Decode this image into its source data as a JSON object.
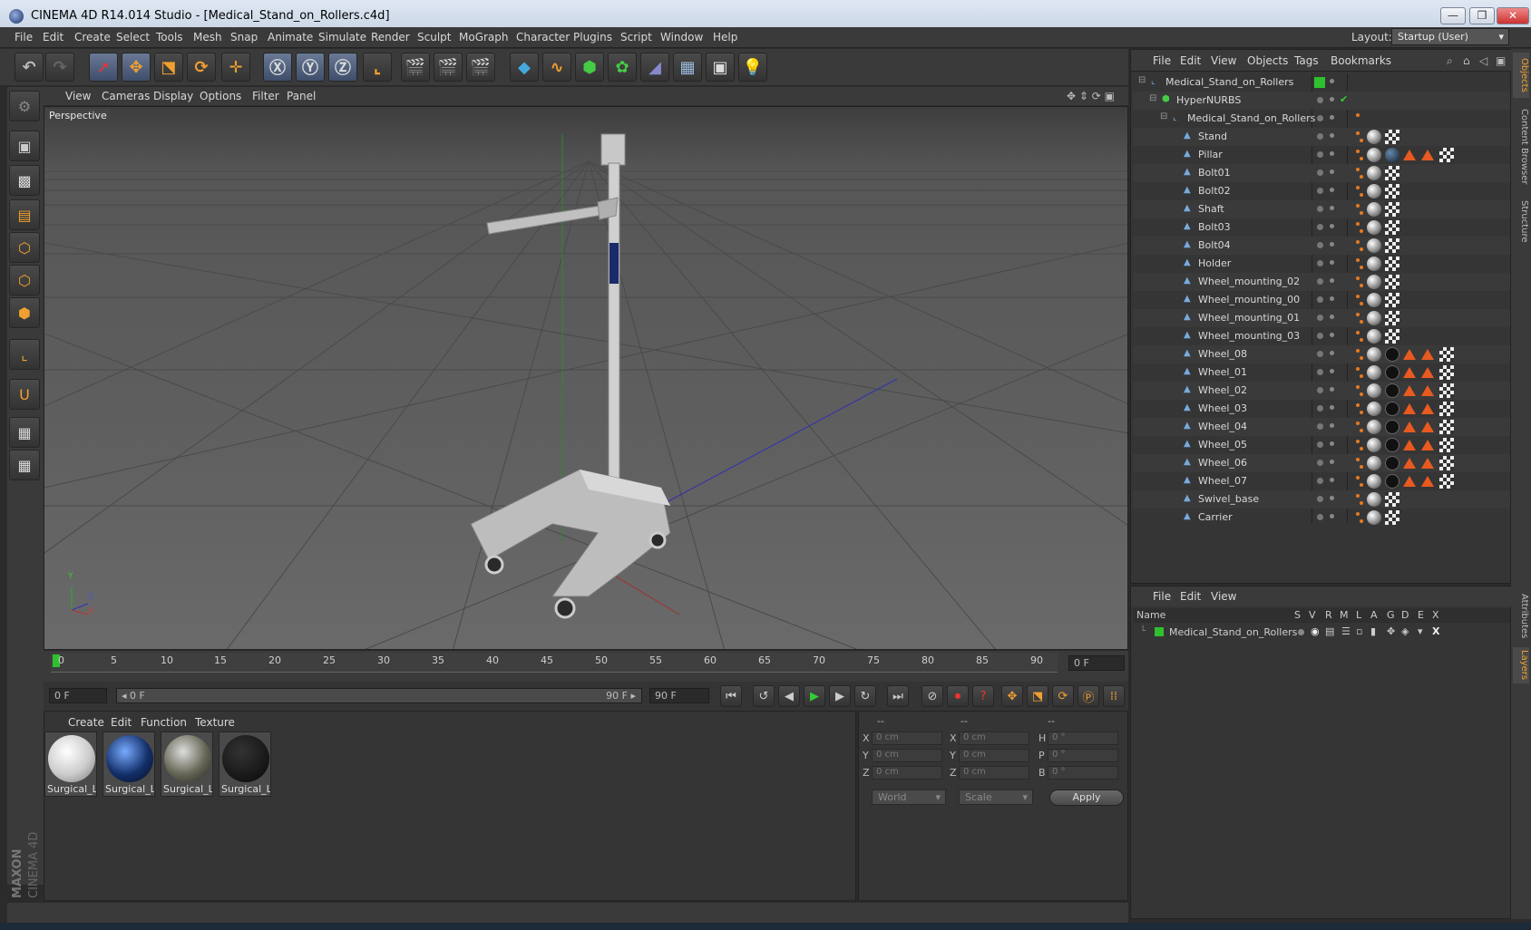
{
  "window": {
    "title": "CINEMA 4D R14.014 Studio - [Medical_Stand_on_Rollers.c4d]",
    "min": "—",
    "max": "❐",
    "close": "✕"
  },
  "menu": [
    "File",
    "Edit",
    "Create",
    "Select",
    "Tools",
    "Mesh",
    "Snap",
    "Animate",
    "Simulate",
    "Render",
    "Sculpt",
    "MoGraph",
    "Character",
    "Plugins",
    "Script",
    "Window",
    "Help"
  ],
  "layout": {
    "label": "Layout:",
    "value": "Startup (User)"
  },
  "viewport": {
    "menu": [
      "View",
      "Cameras",
      "Display",
      "Options",
      "Filter",
      "Panel"
    ],
    "label": "Perspective",
    "axis_y": "Y",
    "axis_z": "Z",
    "axis_x": "X"
  },
  "timeline": {
    "ticks": [
      "0",
      "5",
      "10",
      "15",
      "20",
      "25",
      "30",
      "35",
      "40",
      "45",
      "50",
      "55",
      "60",
      "65",
      "70",
      "75",
      "80",
      "85",
      "90"
    ],
    "current_frame": "0 F",
    "start_field": "0 F",
    "range_start": "◂ 0 F",
    "range_end": "90 F ▸",
    "end_field": "90 F"
  },
  "materials": {
    "menu": [
      "Create",
      "Edit",
      "Function",
      "Texture"
    ],
    "items": [
      "Surgical_Li",
      "Surgical_Li",
      "Surgical_Li",
      "Surgical_Li"
    ]
  },
  "coords": {
    "headers": [
      "--",
      "--",
      "--"
    ],
    "rows": [
      {
        "a": "X",
        "av": "0 cm",
        "b": "X",
        "bv": "0 cm",
        "c": "H",
        "cv": "0 °"
      },
      {
        "a": "Y",
        "av": "0 cm",
        "b": "Y",
        "bv": "0 cm",
        "c": "P",
        "cv": "0 °"
      },
      {
        "a": "Z",
        "av": "0 cm",
        "b": "Z",
        "bv": "0 cm",
        "c": "B",
        "cv": "0 °"
      }
    ],
    "space": "World",
    "mode": "Scale",
    "apply": "Apply"
  },
  "objects": {
    "menu": [
      "File",
      "Edit",
      "View",
      "Objects",
      "Tags",
      "Bookmarks"
    ],
    "items": [
      {
        "name": "Medical_Stand_on_Rollers",
        "depth": 0
      },
      {
        "name": "HyperNURBS",
        "depth": 1
      },
      {
        "name": "Medical_Stand_on_Rollers",
        "depth": 2
      },
      {
        "name": "Stand",
        "depth": 3
      },
      {
        "name": "Pillar",
        "depth": 3
      },
      {
        "name": "Bolt01",
        "depth": 3
      },
      {
        "name": "Bolt02",
        "depth": 3
      },
      {
        "name": "Shaft",
        "depth": 3
      },
      {
        "name": "Bolt03",
        "depth": 3
      },
      {
        "name": "Bolt04",
        "depth": 3
      },
      {
        "name": "Holder",
        "depth": 3
      },
      {
        "name": "Wheel_mounting_02",
        "depth": 3
      },
      {
        "name": "Wheel_mounting_00",
        "depth": 3
      },
      {
        "name": "Wheel_mounting_01",
        "depth": 3
      },
      {
        "name": "Wheel_mounting_03",
        "depth": 3
      },
      {
        "name": "Wheel_08",
        "depth": 3
      },
      {
        "name": "Wheel_01",
        "depth": 3
      },
      {
        "name": "Wheel_02",
        "depth": 3
      },
      {
        "name": "Wheel_03",
        "depth": 3
      },
      {
        "name": "Wheel_04",
        "depth": 3
      },
      {
        "name": "Wheel_05",
        "depth": 3
      },
      {
        "name": "Wheel_06",
        "depth": 3
      },
      {
        "name": "Wheel_07",
        "depth": 3
      },
      {
        "name": "Swivel_base",
        "depth": 3
      },
      {
        "name": "Carrier",
        "depth": 3
      }
    ]
  },
  "layers": {
    "menu": [
      "File",
      "Edit",
      "View"
    ],
    "columns": [
      "Name",
      "S",
      "V",
      "R",
      "M",
      "L",
      "A",
      "G",
      "D",
      "E",
      "X"
    ],
    "rows": [
      {
        "name": "Medical_Stand_on_Rollers",
        "color": "#2fc02f"
      }
    ]
  },
  "side_tabs": [
    "Objects",
    "Content Browser",
    "Structure",
    "Attributes",
    "Layers"
  ],
  "branding": {
    "maxon": "MAXON",
    "product": "CINEMA 4D"
  }
}
